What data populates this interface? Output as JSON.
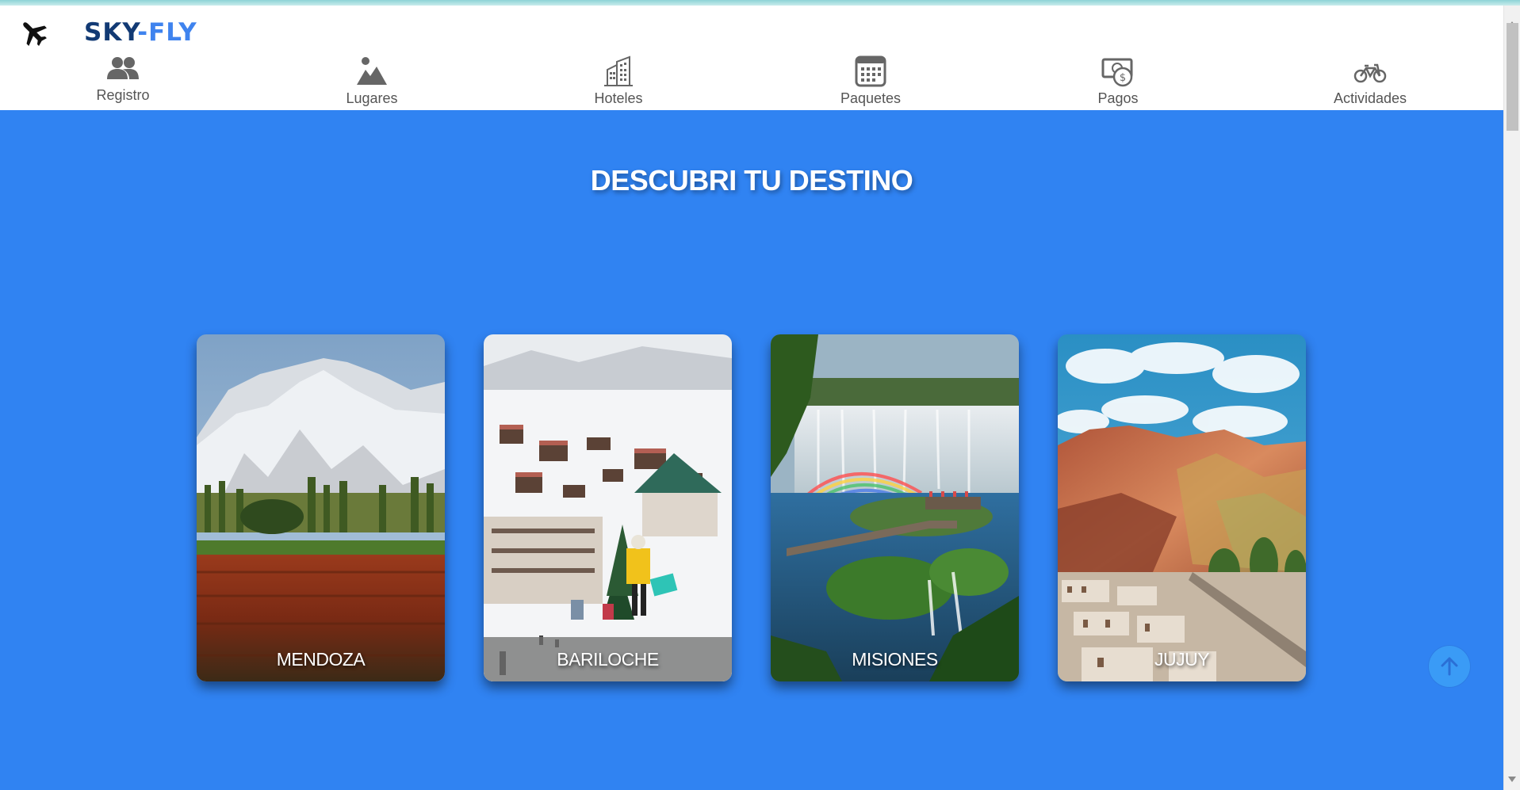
{
  "brand": {
    "sky": "SKY",
    "dash": "-",
    "fly": "FLY",
    "logo_icon": "airplane-icon",
    "colors": {
      "sky": "#123a74",
      "fly": "#3f83ee"
    }
  },
  "nav": {
    "items": [
      {
        "label": "Registro",
        "icon": "users-icon"
      },
      {
        "label": "Lugares",
        "icon": "landscape-icon"
      },
      {
        "label": "Hoteles",
        "icon": "building-icon"
      },
      {
        "label": "Paquetes",
        "icon": "calendar-icon"
      },
      {
        "label": "Pagos",
        "icon": "money-icon"
      },
      {
        "label": "Actividades",
        "icon": "bicycle-icon"
      }
    ]
  },
  "hero": {
    "title": "DESCUBRI TU DESTINO",
    "background": "#3083f2"
  },
  "destinations": [
    {
      "name": "MENDOZA",
      "scene": "snowy-mountains-vineyard"
    },
    {
      "name": "BARILOCHE",
      "scene": "ski-village"
    },
    {
      "name": "MISIONES",
      "scene": "waterfalls-rainbow"
    },
    {
      "name": "JUJUY",
      "scene": "colored-hills-town"
    }
  ],
  "scroll_top": {
    "icon": "arrow-up-icon"
  }
}
